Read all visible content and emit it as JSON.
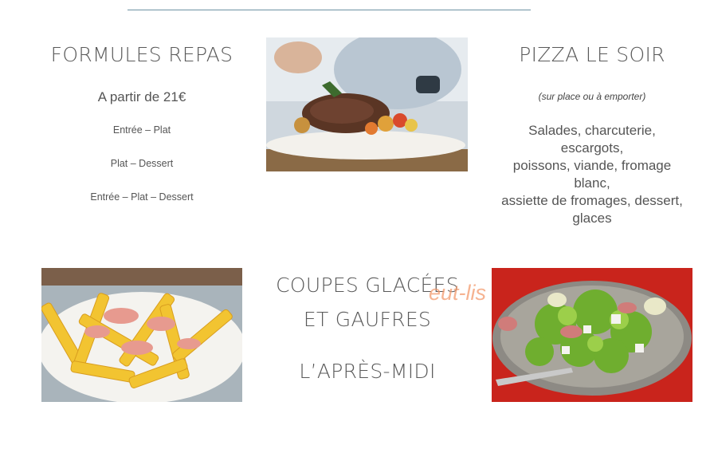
{
  "left": {
    "title": "FORMULES REPAS",
    "price": "A partir de 21€",
    "options": [
      "Entrée – Plat",
      "Plat – Dessert",
      "Entrée – Plat – Dessert"
    ]
  },
  "right": {
    "title": "PIZZA LE SOIR",
    "note": "(sur place ou à emporter)",
    "items": [
      "Salades, charcuterie,",
      "escargots,",
      "poissons, viande, fromage",
      "blanc,",
      "assiette de fromages, dessert,",
      "glaces"
    ]
  },
  "center": {
    "title_line1": "COUPES GLACÉES",
    "title_line2": "ET GAUFRES",
    "subtitle": "L’APRÈS-MIDI"
  },
  "watermark": "eut-lis",
  "images": {
    "steak": "plated-steak-photo",
    "fries": "fries-with-ham-photo",
    "salad": "salad-with-ham-photo"
  },
  "colors": {
    "rule": "#6d93a3",
    "watermark": "#f39a6d"
  }
}
